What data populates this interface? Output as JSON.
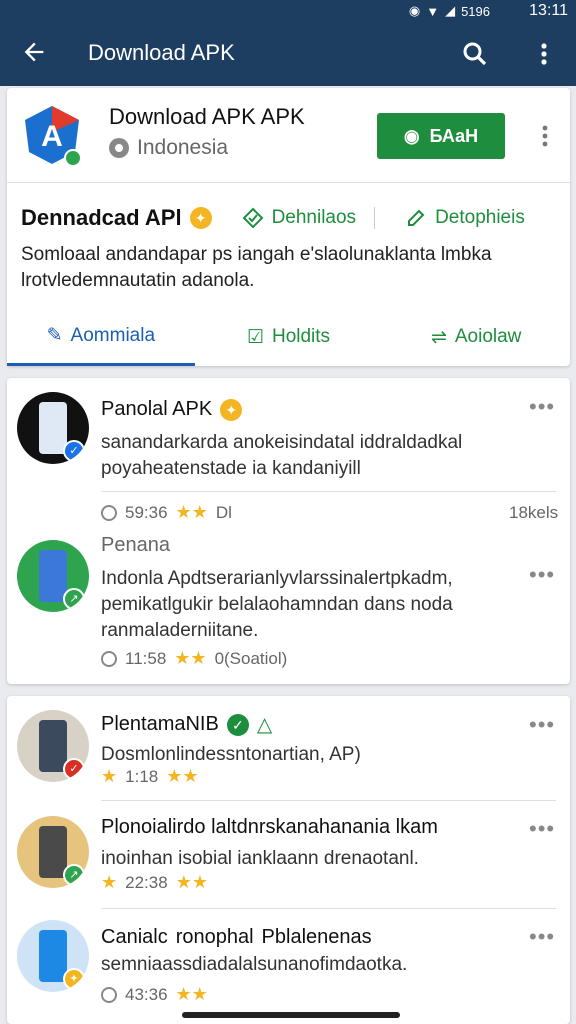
{
  "statusbar": {
    "time": "13:11",
    "signal": "5196",
    "icons": [
      "notification-icon",
      "wifi-icon",
      "signal-icon"
    ]
  },
  "appbar": {
    "title": "Download APK"
  },
  "app": {
    "title": "Download APK APK",
    "region": "Indonesia",
    "download_label": "БАаН",
    "developer": "Dennadcad APl",
    "link1": "Dehnilaos",
    "link2": "Detophieis",
    "description": "Somloaal andandapar ps iangah e'slaolunaklanta lmbka lrotvledemnautatin adanola."
  },
  "tabs": [
    {
      "label": "Aommiala"
    },
    {
      "label": "Holdits"
    },
    {
      "label": "Aoiolaw"
    }
  ],
  "reviews_card1": [
    {
      "name": "Panolal APK",
      "text": "sanandarkarda anokeisindatal iddraldadkal poyaheatenstade ia kandaniyill",
      "time": "59:36",
      "extra": "Dl",
      "count": "18kels"
    },
    {
      "label": "Penana",
      "text": "Indonla Apdtserarianlyvlarssinalertpkadm, pemikatlgukir belalaohamndan dans noda ranmaladerniitane.",
      "time": "11:58",
      "extra": "0(Soatiol)"
    }
  ],
  "reviews_card2": [
    {
      "name": "PlentamaNIB",
      "text": "Dosmlonlindessntonartian, AP)",
      "time": "1:18"
    },
    {
      "name": "Plonoialirdo laltdnrskanahanania lkam",
      "text": "inoinhan isobial ianklaann drenaotanl.",
      "time": "22:38"
    },
    {
      "name": "Canialc",
      "name2": "ronophal",
      "name3": "Pblalenenas",
      "text": "semniaassdiadalalsunanofimdaotka.",
      "time": "43:36"
    }
  ],
  "colors": {
    "appbar": "#1d3e60",
    "accent_green": "#1e8e3e",
    "accent_blue": "#1a5fb4",
    "star": "#f3b622"
  }
}
